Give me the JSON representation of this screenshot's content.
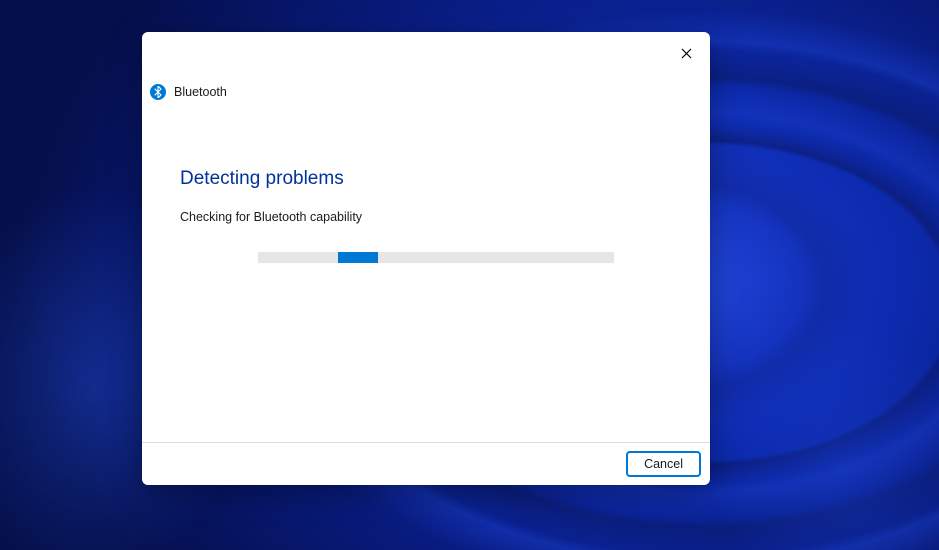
{
  "dialog": {
    "title": "Bluetooth",
    "heading": "Detecting problems",
    "status": "Checking for Bluetooth capability",
    "progress": {
      "indeterminate": true,
      "segment_left_percent": 22,
      "segment_width_percent": 11
    },
    "buttons": {
      "cancel": "Cancel"
    }
  },
  "icons": {
    "bluetooth": "bluetooth-icon",
    "close": "close-icon"
  },
  "colors": {
    "accent": "#0078d4",
    "heading": "#003399",
    "track": "#e6e6e6"
  }
}
